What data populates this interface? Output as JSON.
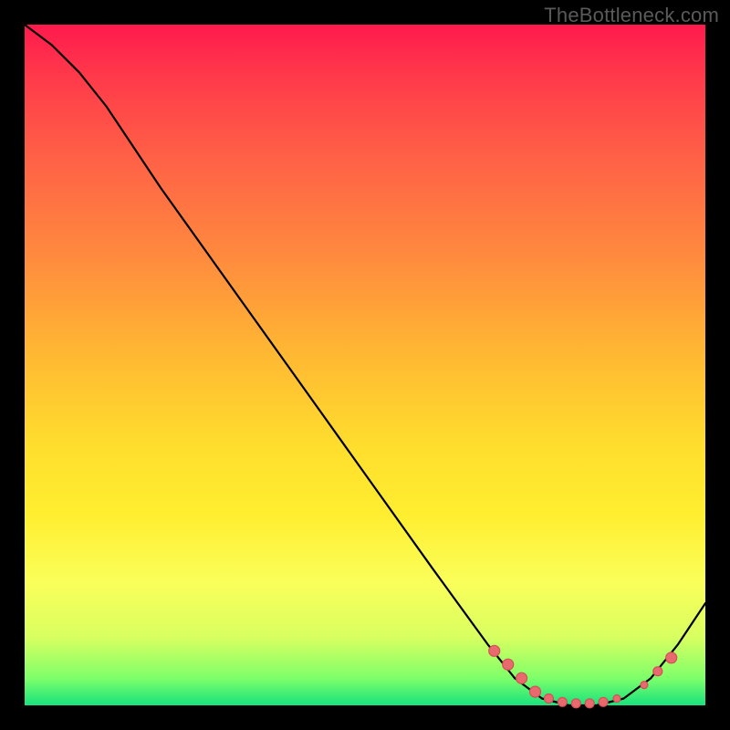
{
  "watermark": "TheBottleneck.com",
  "colors": {
    "frame_bg": "#000000",
    "curve": "#000000",
    "dot_fill": "#e86a6f",
    "dot_stroke": "#d45055",
    "gradient_top": "#ff1a4d",
    "gradient_bottom": "#18e27d"
  },
  "chart_data": {
    "type": "line",
    "title": "",
    "xlabel": "",
    "ylabel": "",
    "xlim": [
      0,
      100
    ],
    "ylim": [
      0,
      100
    ],
    "curve_points": [
      {
        "x": 0,
        "y": 100
      },
      {
        "x": 4,
        "y": 97
      },
      {
        "x": 8,
        "y": 93
      },
      {
        "x": 12,
        "y": 88
      },
      {
        "x": 20,
        "y": 76
      },
      {
        "x": 30,
        "y": 62
      },
      {
        "x": 40,
        "y": 48
      },
      {
        "x": 50,
        "y": 34
      },
      {
        "x": 60,
        "y": 20
      },
      {
        "x": 68,
        "y": 9
      },
      {
        "x": 72,
        "y": 4
      },
      {
        "x": 76,
        "y": 1
      },
      {
        "x": 80,
        "y": 0
      },
      {
        "x": 84,
        "y": 0
      },
      {
        "x": 88,
        "y": 1
      },
      {
        "x": 92,
        "y": 4
      },
      {
        "x": 96,
        "y": 9
      },
      {
        "x": 100,
        "y": 15
      }
    ],
    "marker_points": [
      {
        "x": 69,
        "y": 8,
        "r": 6
      },
      {
        "x": 71,
        "y": 6,
        "r": 6
      },
      {
        "x": 73,
        "y": 4,
        "r": 6
      },
      {
        "x": 75,
        "y": 2,
        "r": 6
      },
      {
        "x": 77,
        "y": 1,
        "r": 5
      },
      {
        "x": 79,
        "y": 0.5,
        "r": 5
      },
      {
        "x": 81,
        "y": 0.3,
        "r": 5
      },
      {
        "x": 83,
        "y": 0.3,
        "r": 5
      },
      {
        "x": 85,
        "y": 0.5,
        "r": 5
      },
      {
        "x": 87,
        "y": 1,
        "r": 4
      },
      {
        "x": 91,
        "y": 3,
        "r": 4
      },
      {
        "x": 93,
        "y": 5,
        "r": 5
      },
      {
        "x": 95,
        "y": 7,
        "r": 6
      }
    ]
  }
}
